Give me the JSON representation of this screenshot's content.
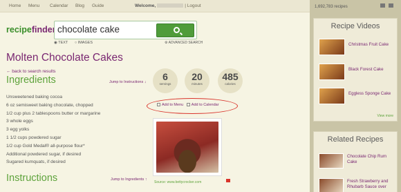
{
  "nav": {
    "items": [
      "Home",
      "Menu",
      "Calendar",
      "Blog",
      "Guide"
    ],
    "welcome": "Welcome,",
    "logout": "| Logout"
  },
  "logo": {
    "part1": "recipe",
    "part2": "finder"
  },
  "search": {
    "value": "chocolate cake",
    "option_text": "TEXT",
    "option_images": "IMAGES",
    "advanced": "ADVANCED SEARCH"
  },
  "recipe": {
    "title": "Molten Chocolate Cakes",
    "back": "← back to search results",
    "ingredients_heading": "Ingredients",
    "jump_to_instructions": "Jump to Instructions ↓",
    "instructions_heading": "Instructions",
    "jump_to_ingredients": "Jump to Ingredients ↑",
    "stats": [
      {
        "value": "6",
        "label": "servings"
      },
      {
        "value": "20",
        "label": "minutes"
      },
      {
        "value": "485",
        "label": "calories"
      }
    ],
    "ingredients": [
      "Unsweetened baking cocoa",
      "6 oz semisweet baking chocolate, chopped",
      "1/2 cup plus 2 tablespoons butter or margarine",
      "3 whole eggs",
      "3 egg yolks",
      "1 1/2 cups powdered sugar",
      "1/2 cup Gold Medal® all-purpose flour*",
      "Additional powdered sugar, if desired",
      "Sugared kumquats, if desired"
    ],
    "add_to_menu": "Add to Menu",
    "add_to_calendar": "Add to Calendar",
    "source": "Source: www.bettycrocker.com"
  },
  "sidebar": {
    "recipe_count": "1,692,783 recipes",
    "videos_heading": "Recipe Videos",
    "videos": [
      "Christmas Fruit Cake",
      "Black Forest Cake",
      "Eggless Sponge Cake"
    ],
    "view_more": "View more",
    "related_heading": "Related Recipes",
    "related": [
      {
        "line1": "Chocolate Chip Rum",
        "line2": "Cake"
      },
      {
        "line1": "Fresh Strawberry and",
        "line2": "Rhubarb Sauce over"
      }
    ]
  },
  "colors": {
    "brand_purple": "#7a2872",
    "brand_green": "#5ea33c",
    "highlight_red": "#d9342b"
  }
}
